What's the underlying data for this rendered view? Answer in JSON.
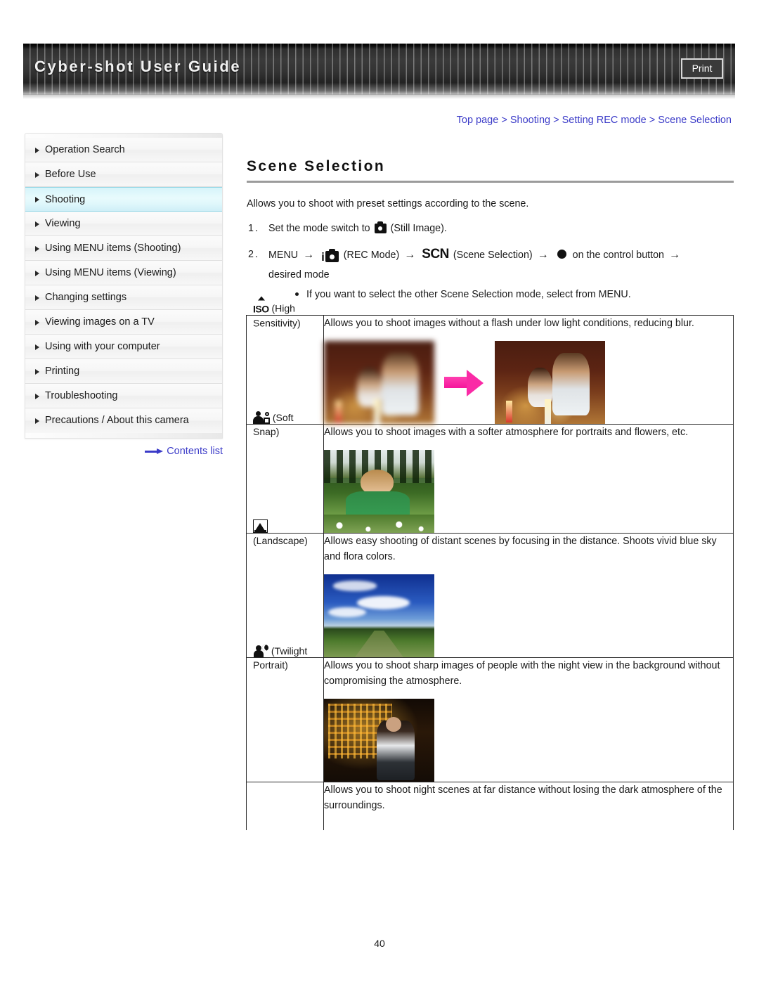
{
  "header": {
    "title": "Cyber-shot User Guide",
    "print_label": "Print"
  },
  "breadcrumb": {
    "text": "Top page > Shooting > Setting REC mode > Scene Selection"
  },
  "sidebar": {
    "items": [
      {
        "label": "Operation Search",
        "active": false
      },
      {
        "label": "Before Use",
        "active": false
      },
      {
        "label": "Shooting",
        "active": true
      },
      {
        "label": "Viewing",
        "active": false
      },
      {
        "label": "Using MENU items (Shooting)",
        "active": false
      },
      {
        "label": "Using MENU items (Viewing)",
        "active": false
      },
      {
        "label": "Changing settings",
        "active": false
      },
      {
        "label": "Viewing images on a TV",
        "active": false
      },
      {
        "label": "Using with your computer",
        "active": false
      },
      {
        "label": "Printing",
        "active": false
      },
      {
        "label": "Troubleshooting",
        "active": false
      },
      {
        "label": "Precautions / About this camera",
        "active": false
      }
    ],
    "contents_link": "Contents list"
  },
  "main": {
    "title": "Scene Selection",
    "intro": "Allows you to shoot with preset settings according to the scene.",
    "step1": {
      "number": "1.",
      "text_before": "Set the mode switch to",
      "icon": "still-image-camera-icon",
      "text_after": "(Still Image)."
    },
    "step2": {
      "number": "2.",
      "menu_label": "MENU",
      "rec_mode_icon": "i-camera-rec-mode-icon",
      "rec_mode_label": "(REC Mode)",
      "scn_icon": "SCN",
      "scn_label": "(Scene Selection)",
      "control_button_icon": "filled-circle-center-button-icon",
      "control_button_label": "on the control button",
      "desired_mode_label": "desired mode",
      "note": "If you want to select the other Scene Selection mode, select from MENU."
    },
    "arrow": "→"
  },
  "table": {
    "rows": [
      {
        "icon": "iso-high-sensitivity-icon",
        "icon_text": "ISO",
        "mode_label": "(High Sensitivity)",
        "description": "Allows you to shoot images without a flash under low light conditions, reducing blur.",
        "images": [
          "blurred-candlelit-dinner-photo",
          "sharp-candlelit-dinner-photo"
        ],
        "has_arrow": true
      },
      {
        "icon": "soft-snap-people-icon",
        "icon_text": "",
        "mode_label": "(Soft Snap)",
        "description": "Allows you to shoot images with a softer atmosphere for portraits and flowers, etc.",
        "images": [
          "boy-in-grass-portrait-photo"
        ],
        "has_arrow": false
      },
      {
        "icon": "landscape-mountain-icon",
        "icon_text": "",
        "mode_label": "(Landscape)",
        "description": "Allows easy shooting of distant scenes by focusing in the distance. Shoots vivid blue sky and flora colors.",
        "images": [
          "blue-sky-field-landscape-photo"
        ],
        "has_arrow": false
      },
      {
        "icon": "twilight-portrait-icon",
        "icon_text": "",
        "mode_label": "(Twilight Portrait)",
        "description": "Allows you to shoot sharp images of people with the night view in the background without compromising the atmosphere.",
        "images": [
          "man-night-cityscape-photo"
        ],
        "has_arrow": false
      },
      {
        "icon": "",
        "icon_text": "",
        "mode_label": "",
        "description": "Allows you to shoot night scenes at far distance without losing the dark atmosphere of the surroundings.",
        "images": [],
        "has_arrow": false
      }
    ]
  },
  "footer": {
    "page_number": "40"
  },
  "colors": {
    "link": "#3b3bc8",
    "active_nav": "#d6f4fa",
    "arrow_pink": "#fa2aa6",
    "header_dark": "#2e2e2e"
  }
}
